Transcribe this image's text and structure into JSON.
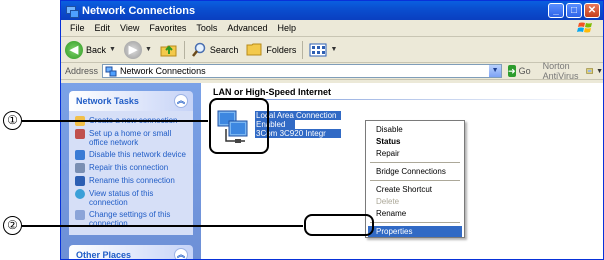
{
  "window": {
    "title": "Network Connections"
  },
  "menubar": [
    "File",
    "Edit",
    "View",
    "Favorites",
    "Tools",
    "Advanced",
    "Help"
  ],
  "toolbar": {
    "back": "Back",
    "search": "Search",
    "folders": "Folders"
  },
  "addressbar": {
    "label": "Address",
    "value": "Network Connections",
    "go": "Go",
    "norton": "Norton AntiVirus"
  },
  "taskpane": {
    "network_tasks": {
      "title": "Network Tasks",
      "items": [
        "Create a new connection",
        "Set up a home or small office network",
        "Disable this network device",
        "Repair this connection",
        "Rename this connection",
        "View status of this connection",
        "Change settings of this connection"
      ]
    },
    "other_places": {
      "title": "Other Places"
    }
  },
  "content": {
    "section_header": "LAN or High-Speed Internet",
    "connection": {
      "line1": "Local Area Connection",
      "line2": "Enabled",
      "line3": "3Com 3C920 Integr"
    }
  },
  "context_menu": {
    "items": [
      "Disable",
      "Status",
      "Repair",
      "Bridge Connections",
      "Create Shortcut",
      "Delete",
      "Rename",
      "Properties"
    ]
  },
  "callouts": {
    "one": "①",
    "two": "②"
  },
  "colors": {
    "titlebar": "#0a4fd0",
    "selection": "#316ac5",
    "taskpane": "#6d8fd6"
  }
}
